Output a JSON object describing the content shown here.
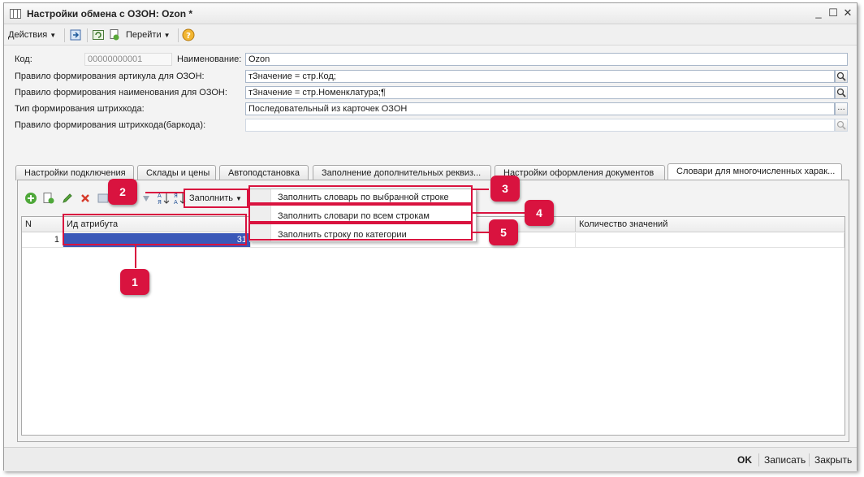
{
  "window": {
    "title": "Настройки обмена с ОЗОН: Ozon *",
    "controls": {
      "minimize": "_",
      "maximize": "☐",
      "close": "✕"
    }
  },
  "toolbar": {
    "actions_label": "Действия",
    "goto_label": "Перейти",
    "icons": [
      "save-close-icon",
      "reread-icon",
      "copy-icon",
      "help-icon"
    ]
  },
  "form": {
    "code_label": "Код:",
    "code_value": "00000000001",
    "name_label": "Наименование:",
    "name_value": "Ozon",
    "article_rule_label": "Правило формирования артикула для ОЗОН:",
    "article_rule_value": "тЗначение =  стр.Код;",
    "name_rule_label": "Правило формирования наименования для ОЗОН:",
    "name_rule_value": "тЗначение =  стр.Номенклатура;¶",
    "barcode_type_label": "Тип формирования штрихкода:",
    "barcode_type_value": "Последовательный из карточек ОЗОН",
    "barcode_rule_label": "Правило формирования штрихкода(баркода):",
    "barcode_rule_value": ""
  },
  "tabs": [
    {
      "label": "Настройки подключения"
    },
    {
      "label": "Склады и цены"
    },
    {
      "label": "Автоподстановка"
    },
    {
      "label": "Заполнение дополнительных реквиз..."
    },
    {
      "label": "Настройки оформления документов"
    },
    {
      "label": "Словари для многочисленных харак..."
    }
  ],
  "panel_toolbar": {
    "fill_label": "Заполнить"
  },
  "fill_menu": {
    "items": [
      {
        "label": "Заполнить словарь по выбранной строке"
      },
      {
        "label": "Заполнить словари по всем строкам"
      },
      {
        "label": "Заполнить строку по категории"
      }
    ]
  },
  "grid": {
    "columns": [
      "N",
      "Ид атрибута",
      "Количество значений"
    ],
    "rows": [
      {
        "n": "1",
        "attr_id": "31",
        "count": ""
      }
    ]
  },
  "callouts": [
    "1",
    "2",
    "3",
    "4",
    "5"
  ],
  "statusbar": {
    "ok_label": "OK",
    "save_label": "Записать",
    "close_label": "Закрыть"
  },
  "colors": {
    "accent": "#d9133f",
    "selection": "#3a58b8"
  }
}
